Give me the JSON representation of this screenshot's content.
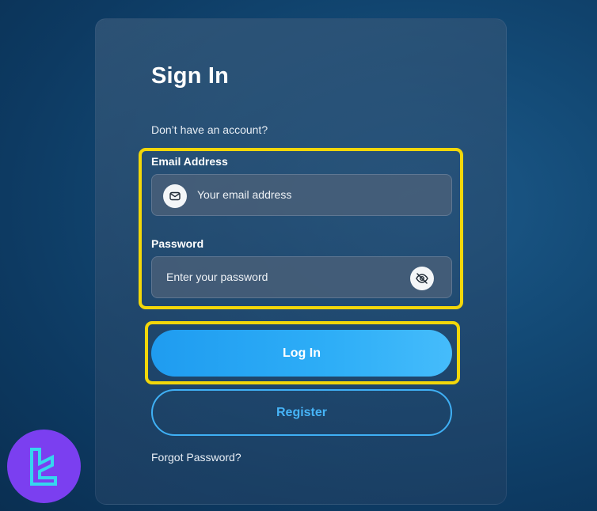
{
  "signin": {
    "title": "Sign In",
    "no_account_text": "Don’t have an account?",
    "email_label": "Email Address",
    "email_placeholder": "Your email address",
    "password_label": "Password",
    "password_placeholder": "Enter your password",
    "login_label": "Log In",
    "register_label": "Register",
    "forgot_label": "Forgot Password?"
  },
  "icons": {
    "email": "mail-icon",
    "password_toggle": "eye-off-icon",
    "brand": "brand-logo"
  },
  "colors": {
    "highlight": "#f2d70a",
    "primary": "#2eaef7",
    "logo_bg": "#7b3ff0",
    "logo_fg": "#35d6ef"
  }
}
